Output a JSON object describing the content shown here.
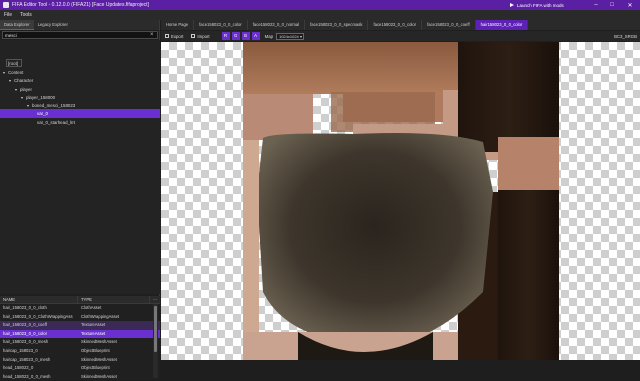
{
  "titlebar": {
    "title": "FIFA Editor Tool - 0.12.0.0 (FIFA21) [Face Updates.fifaproject]",
    "launch_label": "Launch FIFA with mods",
    "minimize": "–",
    "maximize": "□",
    "close": "✕"
  },
  "menu": {
    "file": "File",
    "tools": "Tools"
  },
  "explorer": {
    "tab_data": "Data Explorer",
    "tab_legacy": "Legacy Explorer",
    "search_value": "mesci",
    "tree": [
      {
        "label": "[root]",
        "depth": 0,
        "arrow": ""
      },
      {
        "label": "Content",
        "depth": 0,
        "arrow": "▾"
      },
      {
        "label": "Character",
        "depth": 1,
        "arrow": "▾"
      },
      {
        "label": "player",
        "depth": 2,
        "arrow": "▾"
      },
      {
        "label": "player_158000",
        "depth": 3,
        "arrow": "▾"
      },
      {
        "label": "boned_mesci_158023",
        "depth": 4,
        "arrow": "▾"
      },
      {
        "label": "var_0",
        "depth": 5,
        "arrow": ""
      },
      {
        "label": "var_0_starhead_lrrt",
        "depth": 5,
        "arrow": ""
      }
    ],
    "table_headers": {
      "name": "NAME",
      "type": "TYPE"
    },
    "rows": [
      {
        "name": "hair_158023_0_0_cloth",
        "type": "ClothAsset"
      },
      {
        "name": "hair_158023_0_0_ClothWrappingAss",
        "type": "ClothWrappingAsset"
      },
      {
        "name": "hair_158023_0_0_coeff",
        "type": "TextureAsset"
      },
      {
        "name": "hair_158023_0_0_color",
        "type": "TextureAsset"
      },
      {
        "name": "hair_158023_0_0_mesh",
        "type": "SkinnedMeshAsset"
      },
      {
        "name": "haircap_158023_0",
        "type": "ObjectBlueprint"
      },
      {
        "name": "haircap_158023_0_mesh",
        "type": "SkinnedMeshAsset"
      },
      {
        "name": "head_158023_0",
        "type": "ObjectBlueprint"
      },
      {
        "name": "head_158023_0_0_mesh",
        "type": "SkinnedMeshAsset"
      }
    ]
  },
  "doc_tabs": [
    "Home Page",
    "face158023_0_0_color",
    "face158023_0_0_normal",
    "face158023_0_0_specmask",
    "face158023_0_0_color",
    "face158023_0_0_coeff",
    "hair158023_0_0_color"
  ],
  "toolbar": {
    "export": "Export",
    "import": "Import",
    "channels": [
      "R",
      "G",
      "B",
      "A"
    ],
    "map_label": "Map",
    "map_value": "1024x1024",
    "format": "BC3_SRGB"
  },
  "colors": {
    "accent": "#6a2fd0",
    "titlebar": "#5a1fa3"
  }
}
